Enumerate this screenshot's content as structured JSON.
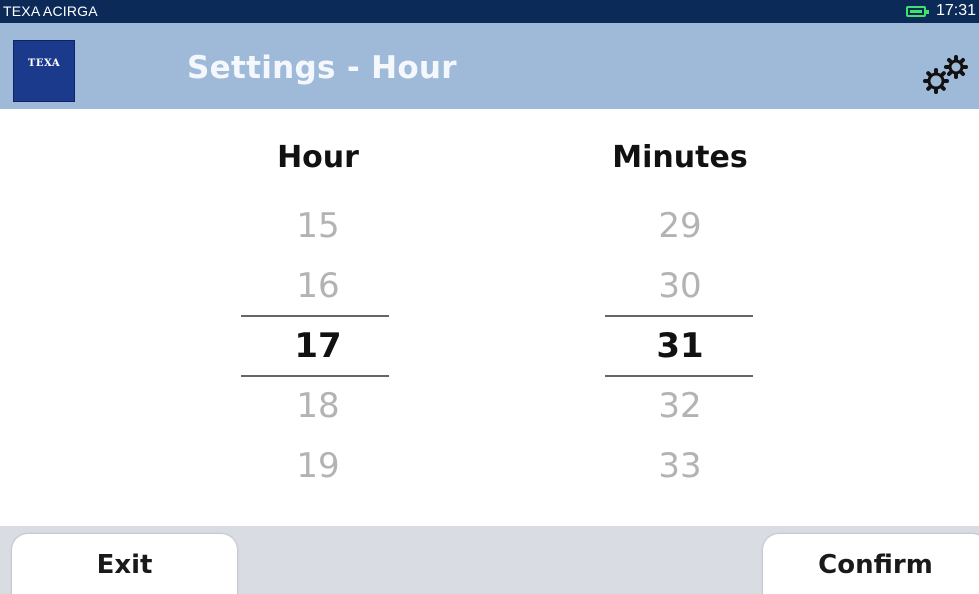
{
  "status_bar": {
    "app_name": "TEXA ACIRGA",
    "time": "17:31",
    "battery_color": "#3fe36b",
    "battery_icon": "battery-icon"
  },
  "header": {
    "logo_text": "TEXA",
    "title": "Settings - Hour",
    "settings_icon": "gears-icon",
    "background": "#9fbad8"
  },
  "pickers": {
    "hour": {
      "label": "Hour",
      "values": [
        "15",
        "16",
        "17",
        "18",
        "19"
      ],
      "selected": "17"
    },
    "minutes": {
      "label": "Minutes",
      "values": [
        "29",
        "30",
        "31",
        "32",
        "33"
      ],
      "selected": "31"
    }
  },
  "footer": {
    "exit_label": "Exit",
    "confirm_label": "Confirm"
  }
}
